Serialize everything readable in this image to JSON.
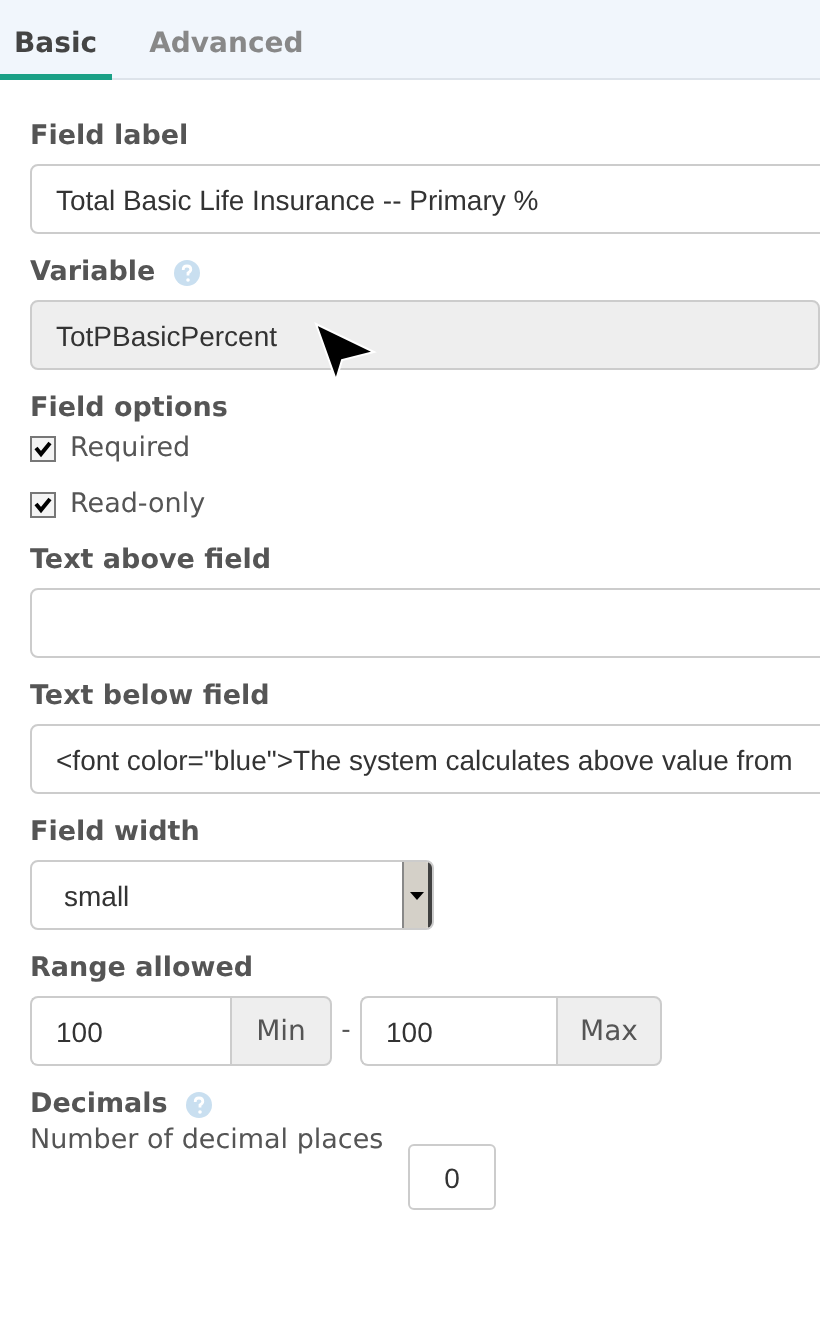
{
  "tabs": [
    {
      "label": "Basic",
      "selected": true
    },
    {
      "label": "Advanced",
      "selected": false
    }
  ],
  "field_label": {
    "label": "Field label",
    "value": "Total Basic Life Insurance -- Primary %"
  },
  "variable": {
    "label": "Variable",
    "value": "TotPBasicPercent",
    "disabled": true
  },
  "field_options": {
    "label": "Field options",
    "options": [
      {
        "label": "Required",
        "checked": true
      },
      {
        "label": "Read-only",
        "checked": true
      }
    ]
  },
  "text_above": {
    "label": "Text above field"
  },
  "text_below": {
    "label": "Text below field",
    "value": "<font color=\"blue\">The system calculates above value from"
  },
  "field_width": {
    "label": "Field width",
    "value": "small"
  },
  "range": {
    "label": "Range allowed",
    "min": {
      "value": "100",
      "addon": "Min"
    },
    "separator": "-",
    "max": {
      "value": "100",
      "addon": "Max"
    }
  },
  "decimals": {
    "label": "Decimals",
    "caption": "Number of decimal places",
    "value": "0"
  }
}
